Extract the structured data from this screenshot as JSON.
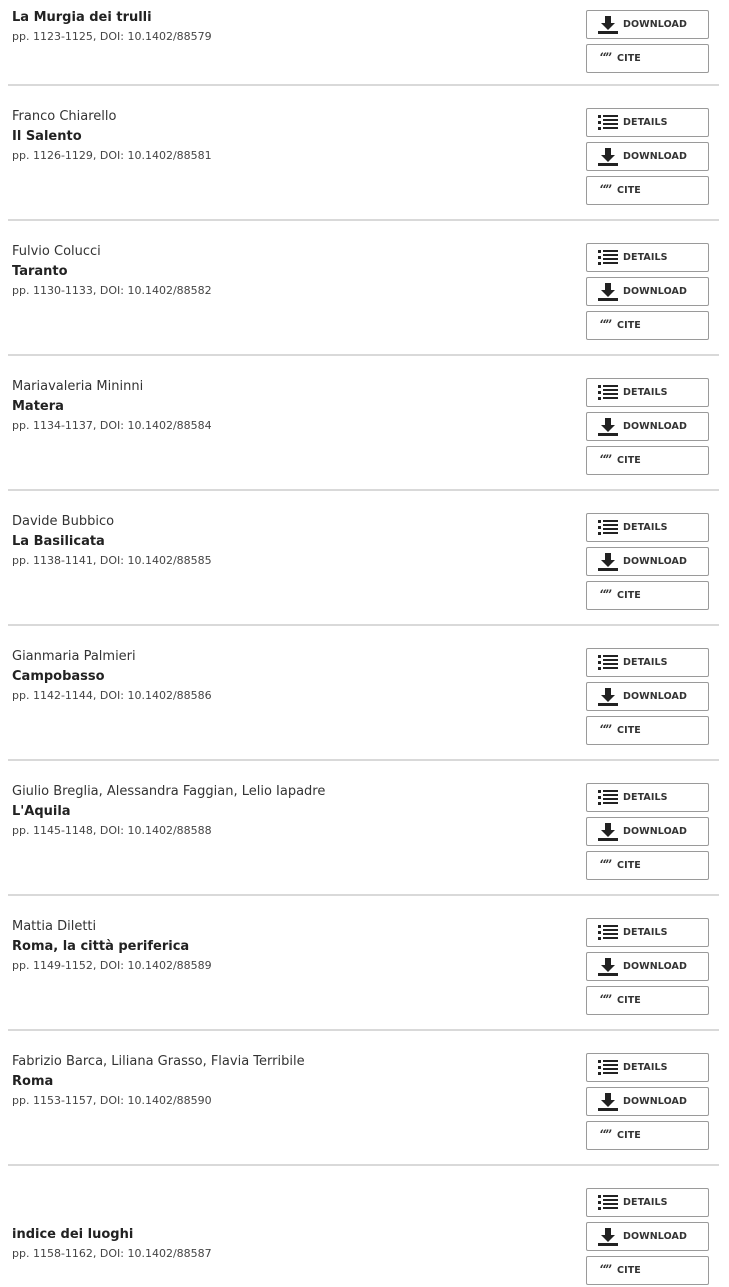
{
  "buttons": {
    "details": "DETAILS",
    "download": "DOWNLOAD",
    "cite": "CITE"
  },
  "icons": {
    "details": "list-icon",
    "download": "download-icon",
    "cite": "quote-icon"
  },
  "entries": [
    {
      "authors": "",
      "title": "La Murgia dei trulli",
      "meta": "pp. 1123-1125, DOI: 10.1402/88579",
      "details": false
    },
    {
      "authors": "Franco Chiarello",
      "title": "Il Salento",
      "meta": "pp. 1126-1129, DOI: 10.1402/88581",
      "details": true
    },
    {
      "authors": "Fulvio Colucci",
      "title": "Taranto",
      "meta": "pp. 1130-1133, DOI: 10.1402/88582",
      "details": true
    },
    {
      "authors": "Mariavaleria Mininni",
      "title": "Matera",
      "meta": "pp. 1134-1137, DOI: 10.1402/88584",
      "details": true
    },
    {
      "authors": "Davide Bubbico",
      "title": "La Basilicata",
      "meta": "pp. 1138-1141, DOI: 10.1402/88585",
      "details": true
    },
    {
      "authors": "Gianmaria Palmieri",
      "title": "Campobasso",
      "meta": "pp. 1142-1144, DOI: 10.1402/88586",
      "details": true
    },
    {
      "authors": "Giulio Breglia, Alessandra Faggian, Lelio Iapadre",
      "title": "L'Aquila",
      "meta": "pp. 1145-1148, DOI: 10.1402/88588",
      "details": true
    },
    {
      "authors": "Mattia Diletti",
      "title": "Roma, la città periferica",
      "meta": "pp. 1149-1152, DOI: 10.1402/88589",
      "details": true
    },
    {
      "authors": "Fabrizio Barca, Liliana Grasso, Flavia Terribile",
      "title": "Roma",
      "meta": "pp. 1153-1157, DOI: 10.1402/88590",
      "details": true
    },
    {
      "authors": "",
      "title": "indice dei luoghi",
      "meta": "pp. 1158-1162, DOI: 10.1402/88587",
      "details": true
    }
  ]
}
